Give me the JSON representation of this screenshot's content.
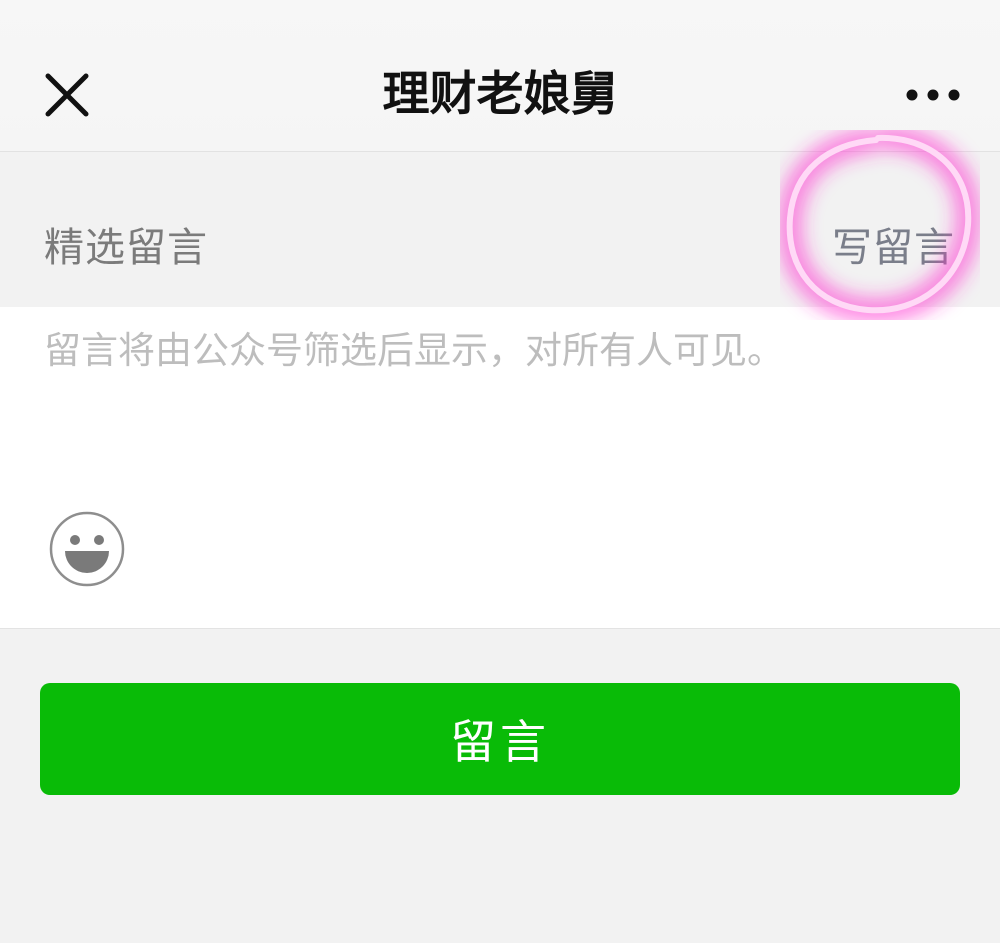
{
  "nav": {
    "title": "理财老娘舅"
  },
  "section": {
    "title": "精选留言",
    "write_label": "写留言"
  },
  "compose": {
    "placeholder": "留言将由公众号筛选后显示，对所有人可见。",
    "value": ""
  },
  "submit": {
    "label": "留言"
  },
  "icons": {
    "close": "close-icon",
    "more": "more-dots-icon",
    "emoji": "smiley-face-icon"
  },
  "colors": {
    "accent_green": "#09bb07",
    "highlight_ring": "#ff3bd4",
    "nav_background": "#f7f7f7",
    "page_background": "#f2f2f2"
  }
}
